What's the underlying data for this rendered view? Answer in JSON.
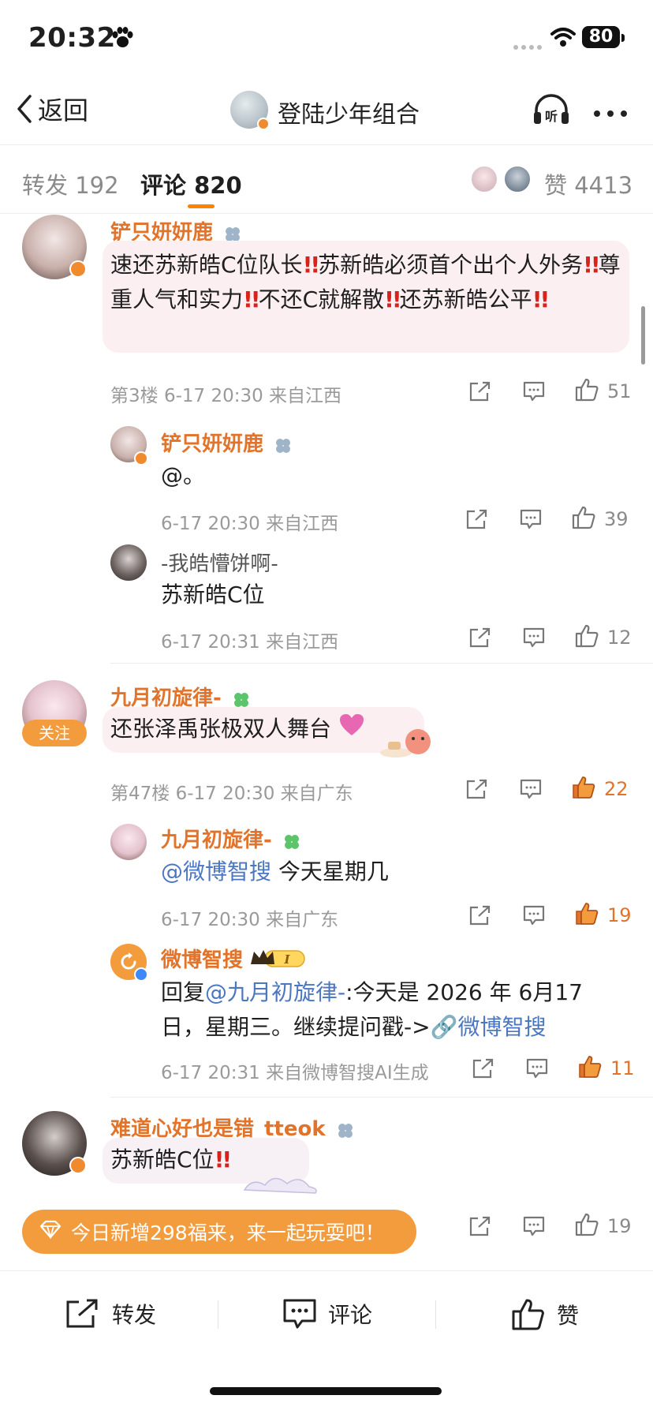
{
  "status_bar": {
    "time": "20:32",
    "battery": "80"
  },
  "nav": {
    "back_label": "返回",
    "title": "登陆少年组合"
  },
  "tabs": {
    "repost": "转发 192",
    "comment": "评论 820",
    "likes": "赞 4413"
  },
  "comments": [
    {
      "user": "铲只妍妍鹿",
      "text_parts": [
        "速还苏新皓C位队长",
        "苏新皓必须首个出个人外务",
        "尊重人气和实力",
        "不还C就解散",
        "还苏新皓公平"
      ],
      "meta": "第3楼 6-17 20:30 来自江西",
      "likes": "51",
      "replies": [
        {
          "user": "铲只妍妍鹿",
          "text": "@。",
          "meta": "6-17 20:30 来自江西",
          "likes": "39"
        },
        {
          "user": "-我皓懵饼啊-",
          "text": "苏新皓C位",
          "meta": "6-17 20:31 来自江西",
          "likes": "12"
        }
      ]
    },
    {
      "user": "九月初旋律-",
      "follow_label": "关注",
      "text": "还张泽禹张极双人舞台",
      "meta": "第47楼 6-17 20:30 来自广东",
      "likes": "22",
      "replies": [
        {
          "user": "九月初旋律-",
          "mention": "@微博智搜",
          "text": " 今天星期几",
          "meta": "6-17 20:30 来自广东",
          "likes": "19"
        },
        {
          "user": "微博智搜",
          "level": "I",
          "reply_prefix": "回复",
          "mention": "@九月初旋律-",
          "text_line1": ":今天是 2026 年 6月17",
          "text_line2": "日，星期三。继续提问戳->",
          "link": "微博智搜",
          "meta": "6-17 20:31 来自微博智搜AI生成",
          "likes": "11"
        }
      ]
    },
    {
      "user": "难道心好也是错_tteok",
      "text": "苏新皓C位",
      "likes": "19"
    }
  ],
  "banner": {
    "text": "今日新增298福来，来一起玩耍吧！"
  },
  "bottom_bar": {
    "repost": "转发",
    "comment": "评论",
    "like": "赞"
  },
  "colors": {
    "accent": "#e2732a",
    "link": "#4b77c2",
    "alert": "#d9221c"
  }
}
